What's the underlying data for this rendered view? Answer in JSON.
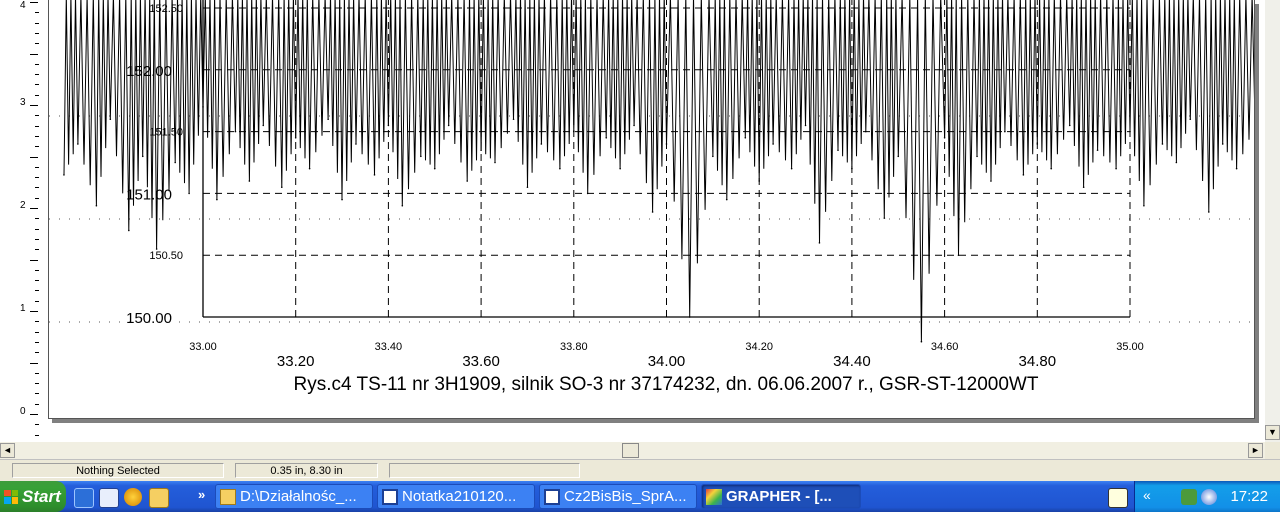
{
  "ruler": {
    "labels": [
      "4",
      "3",
      "2",
      "1",
      "0"
    ]
  },
  "chart_data": {
    "type": "line",
    "title": "Rys.c4 TS-11 nr 3H1909, silnik SO-3 nr 37174232, dn. 06.06.2007 r., GSR-ST-12000WT",
    "xlabel": "",
    "ylabel": "",
    "xlim": [
      33.0,
      35.0
    ],
    "ylim": [
      150.0,
      152.5
    ],
    "x_ticks_major": [
      "33.20",
      "33.60",
      "34.00",
      "34.40",
      "34.80"
    ],
    "x_ticks_minor": [
      "33.00",
      "33.40",
      "33.80",
      "34.20",
      "34.60",
      "35.00"
    ],
    "y_ticks_major": [
      "150.00",
      "151.00",
      "152.00"
    ],
    "y_ticks_minor": [
      "150.50",
      "151.50",
      "152.50"
    ],
    "grid": true,
    "series_color": "#000000",
    "series": [
      {
        "x": [
          32.7,
          32.73,
          32.77,
          32.8,
          32.84,
          32.87,
          32.9,
          32.94,
          32.97,
          33.0,
          33.03,
          33.07,
          33.1,
          33.13,
          33.17,
          33.2,
          33.23,
          33.27,
          33.3,
          33.33,
          33.37,
          33.4,
          33.43,
          33.47,
          33.5,
          33.53,
          33.57,
          33.6,
          33.63,
          33.67,
          33.7,
          33.73,
          33.77,
          33.8,
          33.83,
          33.87,
          33.9,
          33.93,
          33.97,
          34.0,
          34.05,
          34.1,
          34.13,
          34.17,
          34.2,
          34.23,
          34.27,
          34.3,
          34.33,
          34.37,
          34.4,
          34.43,
          34.47,
          34.5,
          34.55,
          34.6,
          34.63,
          34.67,
          34.7,
          34.73,
          34.77,
          34.8,
          34.83,
          34.87,
          34.9,
          34.93,
          34.97,
          35.0,
          35.03,
          35.07,
          35.1,
          35.13,
          35.17,
          35.2,
          35.23,
          35.27
        ],
        "y": [
          151.15,
          151.4,
          150.9,
          151.6,
          150.7,
          151.3,
          150.55,
          151.25,
          151.0,
          151.7,
          150.95,
          151.5,
          151.1,
          151.55,
          151.05,
          151.45,
          151.2,
          151.6,
          150.95,
          151.4,
          151.15,
          151.55,
          150.9,
          151.3,
          151.2,
          151.55,
          151.1,
          151.35,
          151.25,
          151.6,
          151.05,
          151.4,
          151.2,
          151.5,
          151.0,
          151.45,
          151.2,
          151.55,
          150.85,
          151.4,
          150.0,
          151.3,
          150.95,
          151.45,
          151.1,
          151.4,
          151.2,
          151.55,
          150.6,
          151.35,
          151.2,
          151.5,
          150.8,
          151.3,
          149.8,
          151.45,
          150.5,
          151.3,
          151.1,
          151.5,
          151.15,
          151.4,
          151.2,
          151.55,
          151.05,
          151.35,
          151.2,
          151.5,
          150.9,
          151.4,
          151.25,
          151.6,
          150.85,
          151.4,
          151.2,
          151.55
        ]
      }
    ]
  },
  "scrollbar": {
    "left_arrow": "◄",
    "right_arrow": "►",
    "down_arrow": "▼"
  },
  "status": {
    "selection": "Nothing Selected",
    "position": "0.35 in, 8.30 in",
    "extra": ""
  },
  "taskbar": {
    "start_label": "Start",
    "more_chevron": "»",
    "tasks": [
      {
        "label": "D:\\Działalnośc_...",
        "icon": "folder-icon"
      },
      {
        "label": "Notatka210120...",
        "icon": "word-icon"
      },
      {
        "label": "Cz2BisBis_SprA...",
        "icon": "word-icon"
      },
      {
        "label": "GRAPHER - [...",
        "icon": "grapher-icon"
      }
    ],
    "tray_chevron": "«",
    "clock": "17:22"
  },
  "colors": {
    "taskbar": "#245edb",
    "start": "#38a137",
    "tray": "#1290e8",
    "window_chrome": "#ece9d8"
  }
}
